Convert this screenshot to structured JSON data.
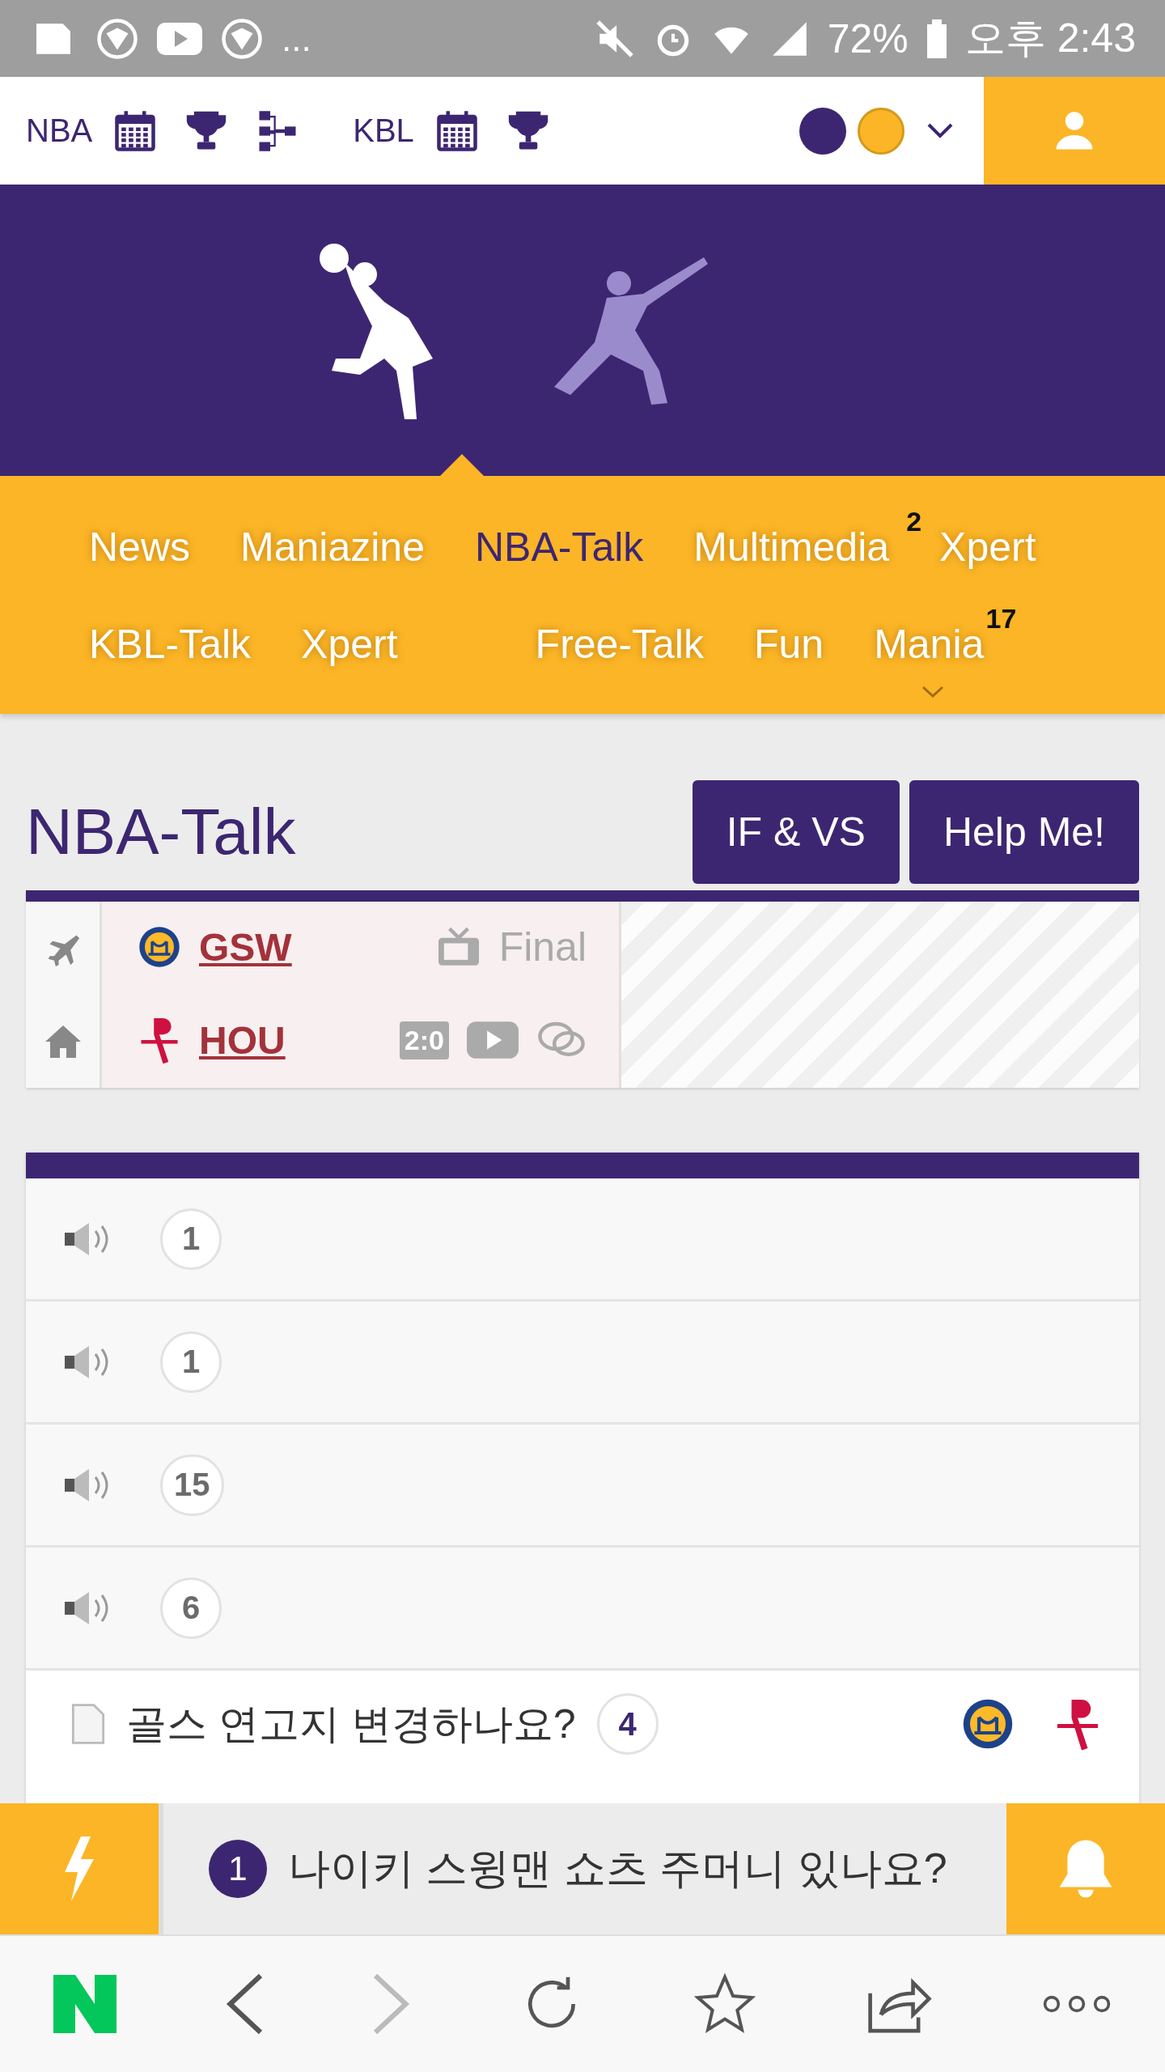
{
  "status_bar": {
    "more": "...",
    "battery": "72%",
    "time": "오후 2:43"
  },
  "top_nav": {
    "leagues": [
      {
        "label": "NBA"
      },
      {
        "label": "KBL"
      }
    ],
    "theme_swatches": [
      {
        "color": "#3d2671",
        "selected": true
      },
      {
        "color": "#fbb526",
        "selected": false
      }
    ]
  },
  "hero": {
    "sports": [
      {
        "kind": "basketball",
        "selected": true
      },
      {
        "kind": "baseball",
        "selected": false
      }
    ]
  },
  "menu": {
    "rows": [
      [
        {
          "label": "News",
          "selected": false
        },
        {
          "label": "Maniazine",
          "selected": false
        },
        {
          "label": "NBA-Talk",
          "selected": true
        },
        {
          "label": "Multimedia",
          "selected": false,
          "badge": "2"
        },
        {
          "label": "Xpert",
          "selected": false
        }
      ],
      [
        {
          "label": "KBL-Talk",
          "selected": false
        },
        {
          "label": "Xpert",
          "selected": false
        },
        {
          "label": "Free-Talk",
          "selected": false
        },
        {
          "label": "Fun",
          "selected": false
        },
        {
          "label": "Mania",
          "selected": false,
          "badge": "17"
        }
      ]
    ]
  },
  "page_title": "NBA-Talk",
  "buttons": [
    "IF & VS",
    "Help Me!"
  ],
  "game": {
    "teams": [
      {
        "abbr": "GSW",
        "kind": "away"
      },
      {
        "abbr": "HOU",
        "kind": "home"
      }
    ],
    "status": "Final",
    "score": "2:0"
  },
  "notices": [
    {
      "count": "1"
    },
    {
      "count": "1"
    },
    {
      "count": "15"
    },
    {
      "count": "6"
    }
  ],
  "posts": [
    {
      "title": "골스 연고지 변경하나요?",
      "comments": "4"
    }
  ],
  "notification": {
    "count": "1",
    "text": "나이키 스윙맨 쇼츠 주머니 있나요?"
  }
}
